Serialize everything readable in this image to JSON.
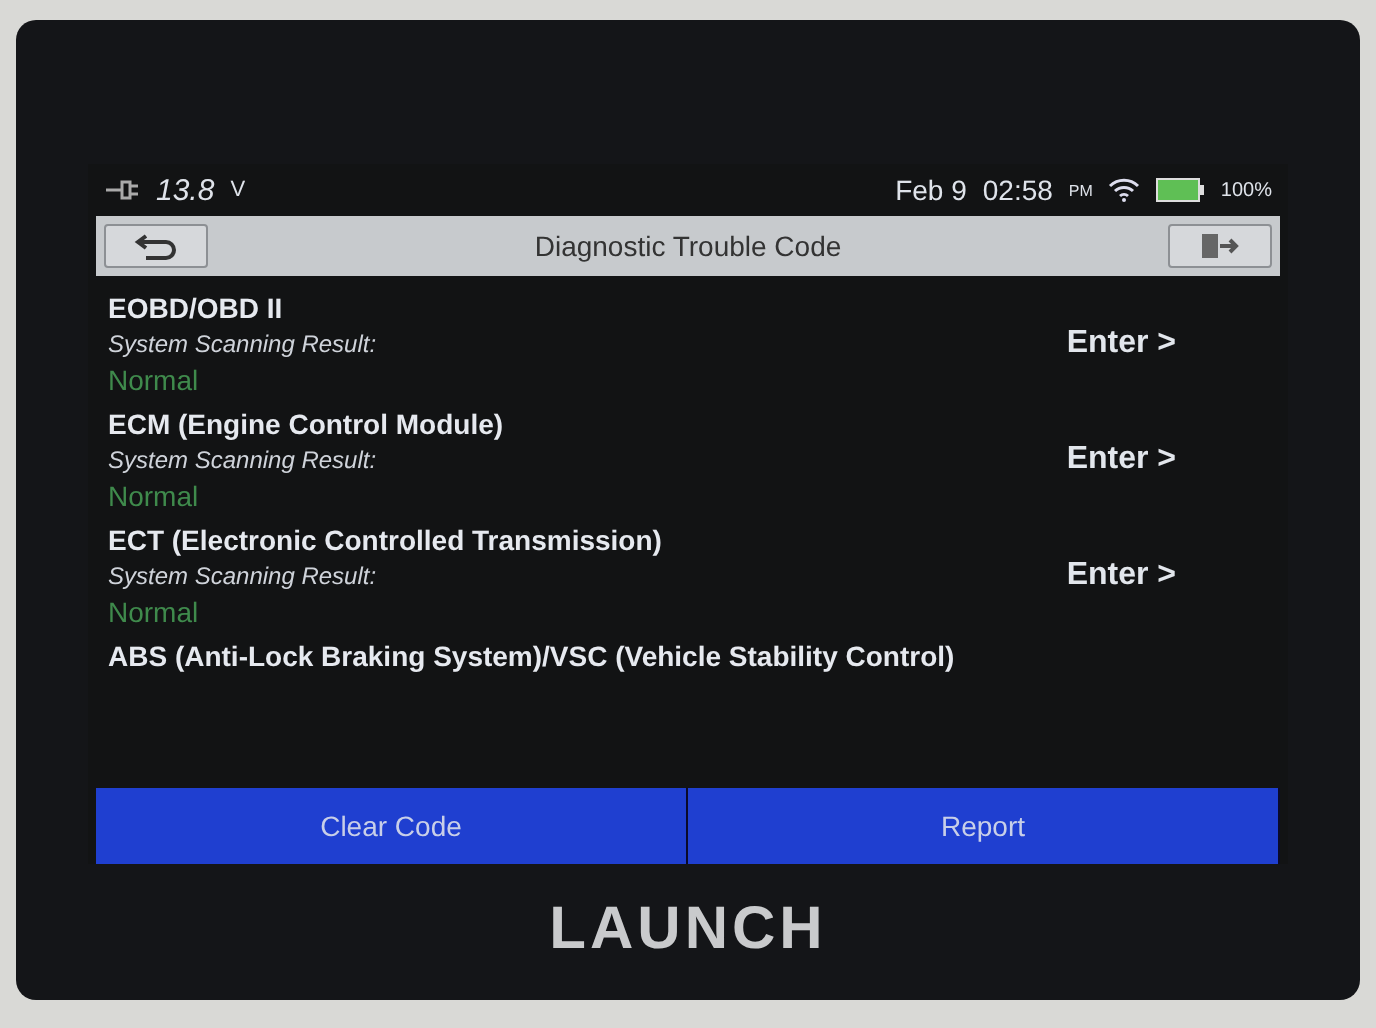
{
  "status_bar": {
    "voltage": "13.8",
    "voltage_unit": "V",
    "date": "Feb 9",
    "time": "02:58",
    "meridiem": "PM",
    "battery": "100%"
  },
  "title_bar": {
    "title": "Diagnostic Trouble Code"
  },
  "systems": [
    {
      "name": "EOBD/OBD II",
      "label": "System Scanning Result:",
      "result": "Normal",
      "action": "Enter >"
    },
    {
      "name": "ECM (Engine Control Module)",
      "label": "System Scanning Result:",
      "result": "Normal",
      "action": "Enter >"
    },
    {
      "name": "ECT (Electronic Controlled Transmission)",
      "label": "System Scanning Result:",
      "result": "Normal",
      "action": "Enter >"
    },
    {
      "name": "ABS (Anti-Lock Braking System)/VSC (Vehicle Stability Control)"
    }
  ],
  "buttons": [
    "Clear Code",
    "Report"
  ],
  "brand": "LAUNCH"
}
